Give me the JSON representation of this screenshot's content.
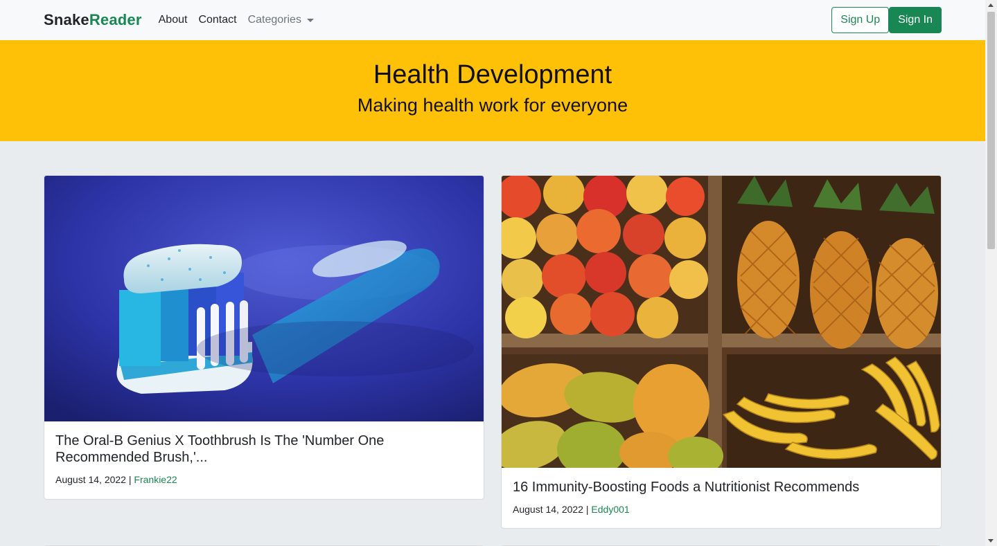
{
  "navbar": {
    "brand_part1": "Snake",
    "brand_part2": "Reader",
    "links": [
      "About",
      "Contact"
    ],
    "categories_label": "Categories",
    "signup_label": "Sign Up",
    "signin_label": "Sign In"
  },
  "hero": {
    "title": "Health Development",
    "subtitle": "Making health work for everyone"
  },
  "posts": [
    {
      "title": "The Oral-B Genius X Toothbrush Is The 'Number One Recommended Brush,'...",
      "date": "August 14, 2022",
      "separator": " | ",
      "author": "Frankie22",
      "image_icon": "toothbrush-image"
    },
    {
      "title": "16 Immunity-Boosting Foods a Nutritionist Recommends",
      "date": "August 14, 2022",
      "separator": " | ",
      "author": "Eddy001",
      "image_icon": "fruit-crates-image"
    }
  ],
  "colors": {
    "accent": "#198754",
    "hero_bg": "#ffc107",
    "page_bg": "#e9ecef"
  }
}
